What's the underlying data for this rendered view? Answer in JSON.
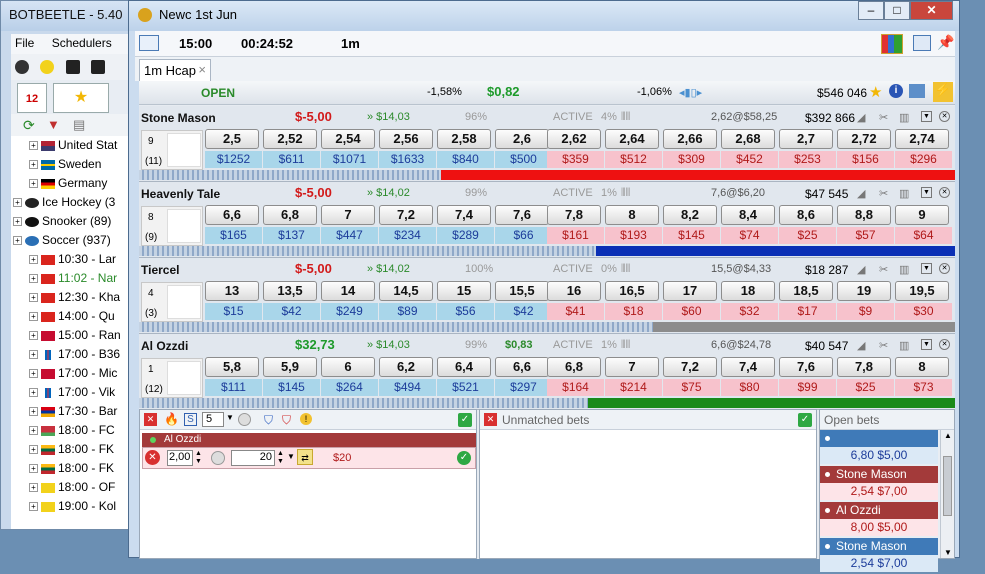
{
  "bg_app": {
    "title": "BOTBEETLE - 5.40",
    "menu": [
      "File",
      "Schedulers"
    ],
    "calendar_label": "12",
    "tree": [
      {
        "label": "United Stat",
        "flag": "us",
        "indent": 1
      },
      {
        "label": "Sweden",
        "flag": "se",
        "indent": 1
      },
      {
        "label": "Germany",
        "flag": "de",
        "indent": 1
      },
      {
        "label": "Ice Hockey (3",
        "flag": "hockey",
        "indent": 0
      },
      {
        "label": "Snooker (89)",
        "flag": "snooker",
        "indent": 0
      },
      {
        "label": "Soccer (937)",
        "flag": "soccer",
        "indent": 0
      },
      {
        "label": "10:30 - Lar",
        "flag": "vn",
        "indent": 1
      },
      {
        "label": "11:02 - Nar",
        "flag": "vn",
        "indent": 1,
        "green": true
      },
      {
        "label": "12:30 - Kha",
        "flag": "vn",
        "indent": 1
      },
      {
        "label": "14:00 - Qu",
        "flag": "vn",
        "indent": 1
      },
      {
        "label": "15:00 - Ran",
        "flag": "dk",
        "indent": 1
      },
      {
        "label": "17:00 - B36",
        "flag": "fo",
        "indent": 1
      },
      {
        "label": "17:00 - Mic",
        "flag": "dk",
        "indent": 1
      },
      {
        "label": "17:00 - Vik",
        "flag": "fo",
        "indent": 1
      },
      {
        "label": "17:30 - Bar",
        "flag": "am",
        "indent": 1
      },
      {
        "label": "18:00 - FC",
        "flag": "by",
        "indent": 1
      },
      {
        "label": "18:00 - FK",
        "flag": "lt",
        "indent": 1
      },
      {
        "label": "18:00 - FK",
        "flag": "lt",
        "indent": 1
      },
      {
        "label": "18:00 - OF",
        "flag": "doc",
        "indent": 1
      },
      {
        "label": "19:00 - Kol",
        "flag": "doc",
        "indent": 1
      }
    ]
  },
  "window": {
    "title": "Newc 1st Jun",
    "btn_min": "–",
    "btn_max": "□",
    "btn_close": "✕"
  },
  "toolbar": {
    "start_time": "15:00",
    "countdown": "00:24:52",
    "market_type": "1m"
  },
  "tab": {
    "label": "1m Hcap",
    "close": "×"
  },
  "market": {
    "status": "OPEN",
    "back_pct": "-1,58%",
    "total_pl": "$0,82",
    "lay_pct": "-1,06%",
    "matched": "$546 046"
  },
  "colors": {
    "back": "#a9d6ea",
    "lay": "#f7c2cc",
    "red_bar": "#ee1111",
    "blue_bar": "#0a2fb5",
    "grey_bar": "#8c8c8c",
    "green_bar": "#1a8a1a"
  },
  "runners": [
    {
      "name": "Stone Mason",
      "pl": "$-5,00",
      "pl_sign": "neg",
      "sp": "» $14,03",
      "book": "96%",
      "extra": "",
      "state": "ACTIVE",
      "state_pct": "4%",
      "last": "2,62@$58,25",
      "volume": "$392 866",
      "number": "9",
      "sub": "(11)",
      "back_odds": [
        "2,5",
        "2,52",
        "2,54",
        "2,56",
        "2,58",
        "2,6"
      ],
      "back_amts": [
        "$1252",
        "$611",
        "$1071",
        "$1633",
        "$840",
        "$500"
      ],
      "lay_odds": [
        "2,62",
        "2,64",
        "2,66",
        "2,68",
        "2,7",
        "2,72",
        "2,74"
      ],
      "lay_amts": [
        "$359",
        "$512",
        "$309",
        "$452",
        "$253",
        "$156",
        "$296"
      ],
      "bar_color": "red_bar",
      "bar_start": 0.37,
      "bar_end": 1.0
    },
    {
      "name": "Heavenly Tale",
      "pl": "$-5,00",
      "pl_sign": "neg",
      "sp": "» $14,02",
      "book": "99%",
      "extra": "",
      "state": "ACTIVE",
      "state_pct": "1%",
      "last": "7,6@$6,20",
      "volume": "$47 545",
      "number": "8",
      "sub": "(9)",
      "back_odds": [
        "6,6",
        "6,8",
        "7",
        "7,2",
        "7,4",
        "7,6"
      ],
      "back_amts": [
        "$165",
        "$137",
        "$447",
        "$234",
        "$289",
        "$66"
      ],
      "lay_odds": [
        "7,8",
        "8",
        "8,2",
        "8,4",
        "8,6",
        "8,8",
        "9"
      ],
      "lay_amts": [
        "$161",
        "$193",
        "$145",
        "$74",
        "$25",
        "$57",
        "$64"
      ],
      "bar_color": "blue_bar",
      "bar_start": 0.56,
      "bar_end": 1.0
    },
    {
      "name": "Tiercel",
      "pl": "$-5,00",
      "pl_sign": "neg",
      "sp": "» $14,02",
      "book": "100%",
      "extra": "",
      "state": "ACTIVE",
      "state_pct": "0%",
      "last": "15,5@$4,33",
      "volume": "$18 287",
      "number": "4",
      "sub": "(3)",
      "back_odds": [
        "13",
        "13,5",
        "14",
        "14,5",
        "15",
        "15,5"
      ],
      "back_amts": [
        "$15",
        "$42",
        "$249",
        "$89",
        "$56",
        "$42"
      ],
      "lay_odds": [
        "16",
        "16,5",
        "17",
        "18",
        "18,5",
        "19",
        "19,5"
      ],
      "lay_amts": [
        "$41",
        "$18",
        "$60",
        "$32",
        "$17",
        "$9",
        "$30"
      ],
      "bar_color": "grey_bar",
      "bar_start": 0.63,
      "bar_end": 1.0
    },
    {
      "name": "Al Ozzdi",
      "pl": "$32,73",
      "pl_sign": "pos",
      "sp": "» $14,03",
      "book": "99%",
      "extra": "$0,83",
      "state": "ACTIVE",
      "state_pct": "1%",
      "last": "6,6@$24,78",
      "volume": "$40 547",
      "number": "1",
      "sub": "(12)",
      "back_odds": [
        "5,8",
        "5,9",
        "6",
        "6,2",
        "6,4",
        "6,6"
      ],
      "back_amts": [
        "$111",
        "$145",
        "$264",
        "$494",
        "$521",
        "$297"
      ],
      "lay_odds": [
        "6,8",
        "7",
        "7,2",
        "7,4",
        "7,6",
        "7,8",
        "8"
      ],
      "lay_amts": [
        "$164",
        "$214",
        "$75",
        "$80",
        "$99",
        "$25",
        "$73"
      ],
      "bar_color": "green_bar",
      "bar_start": 0.55,
      "bar_end": 1.0
    }
  ],
  "betslip": {
    "stake_count": "5",
    "selection": "Al Ozzdi",
    "odds": "2,00",
    "stake": "20",
    "liability": "$20"
  },
  "unmatched": {
    "title": "Unmatched bets"
  },
  "openbets": {
    "title": "Open bets",
    "items": [
      {
        "name": "",
        "value": "6,80   $5,00",
        "type": "back"
      },
      {
        "name": "Stone Mason",
        "value": "2,54   $7,00",
        "type": "lay"
      },
      {
        "name": "Al Ozzdi",
        "value": "8,00   $5,00",
        "type": "lay"
      },
      {
        "name": "Stone Mason",
        "value": "2,54   $7,00",
        "type": "back"
      }
    ]
  }
}
